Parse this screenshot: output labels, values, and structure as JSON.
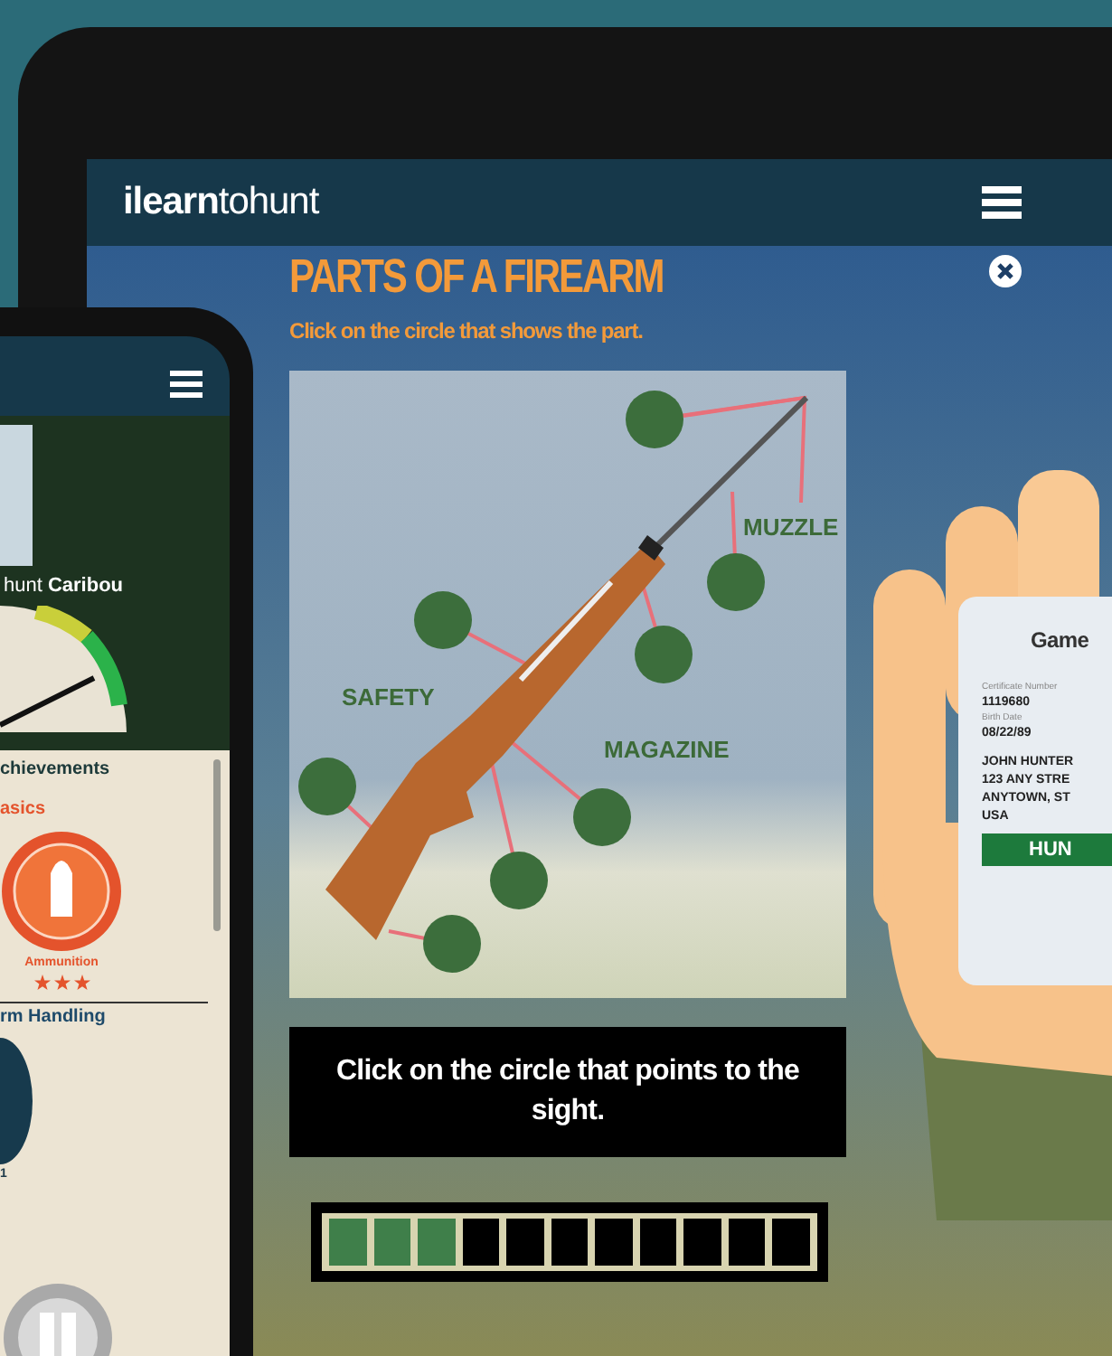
{
  "tablet": {
    "logo": {
      "bold": "ilearn",
      "light": "tohunt"
    },
    "activity": {
      "title": "PARTS OF A FIREARM",
      "subtitle": "Click on the circle that shows the part.",
      "labels": [
        {
          "text": "MUZZLE"
        },
        {
          "text": "SAFETY"
        },
        {
          "text": "MAGAZINE"
        }
      ],
      "prompt": "Click on the circle that points to the sight.",
      "progress": [
        {
          "done": true
        },
        {
          "done": true
        },
        {
          "done": true
        },
        {
          "done": false
        },
        {
          "done": false
        },
        {
          "done": false
        },
        {
          "done": false
        },
        {
          "done": false
        },
        {
          "done": false
        },
        {
          "done": false
        },
        {
          "done": false
        }
      ]
    }
  },
  "phone": {
    "caption": "hunt **Caribou**",
    "heading": "chievements",
    "sections": [
      {
        "title": "asics",
        "badges": [
          {
            "kind": "ammo",
            "label": "Ammunition",
            "stars": 3
          }
        ]
      },
      {
        "title": "rm Handling",
        "badges": [
          {
            "kind": "seal",
            "label": "1"
          }
        ]
      }
    ]
  },
  "card": {
    "title": "Game",
    "fields": [
      {
        "label": "Certificate Number",
        "value": "1119680"
      },
      {
        "label": "Birth Date",
        "value": "08/22/89"
      }
    ],
    "address": [
      "JOHN HUNTER",
      "123 ANY STRE",
      "ANYTOWN, ST",
      "USA"
    ],
    "banner": "HUN"
  }
}
